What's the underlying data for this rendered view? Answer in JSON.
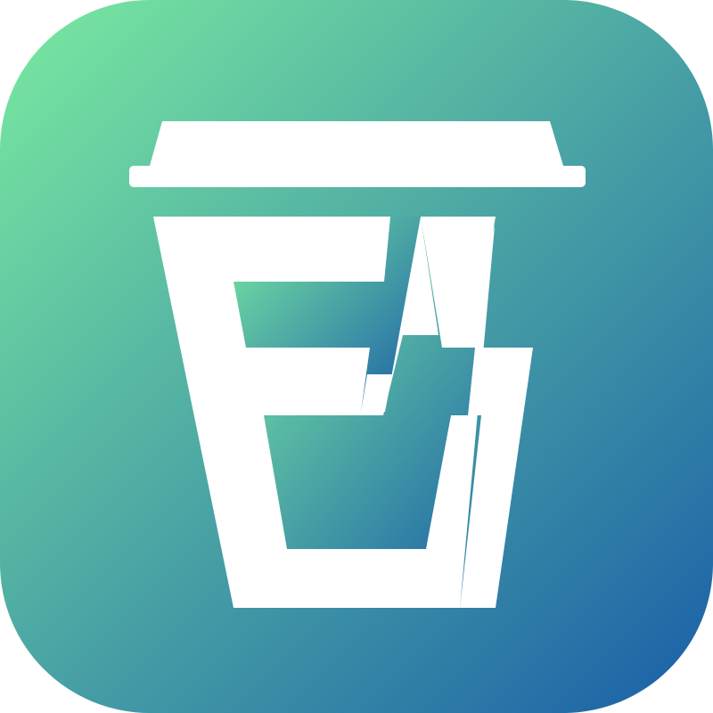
{
  "icon": {
    "name": "coffee-cup-lightning-app-icon",
    "colors": {
      "gradient_start": "#7aeaa0",
      "gradient_end": "#1a5ea8",
      "glyph": "#ffffff"
    }
  }
}
